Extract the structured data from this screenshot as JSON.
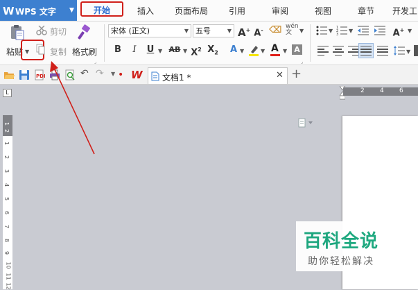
{
  "app": {
    "name": "WPS 文字"
  },
  "menu": {
    "items": [
      "开始",
      "插入",
      "页面布局",
      "引用",
      "审阅",
      "视图",
      "章节",
      "开发工"
    ]
  },
  "ribbon": {
    "paste": "粘贴",
    "cut": "剪切",
    "copy": "复制",
    "format_painter": "格式刷",
    "font_name": "宋体 (正文)",
    "font_size": "五号"
  },
  "tabs": {
    "document": "文档1 *"
  },
  "ruler": {
    "h_numbers": [
      "2",
      "4",
      "6"
    ],
    "v_numbers": [
      "1",
      "2",
      "1",
      "2",
      "3",
      "4",
      "5",
      "6",
      "7",
      "8",
      "9",
      "10",
      "11",
      "12"
    ]
  },
  "watermark": {
    "title": "百科全说",
    "subtitle": "助你轻松解决"
  },
  "colors": {
    "accent": "#3d80d0",
    "highlight_box": "#d0201a",
    "watermark": "#14a57a"
  }
}
